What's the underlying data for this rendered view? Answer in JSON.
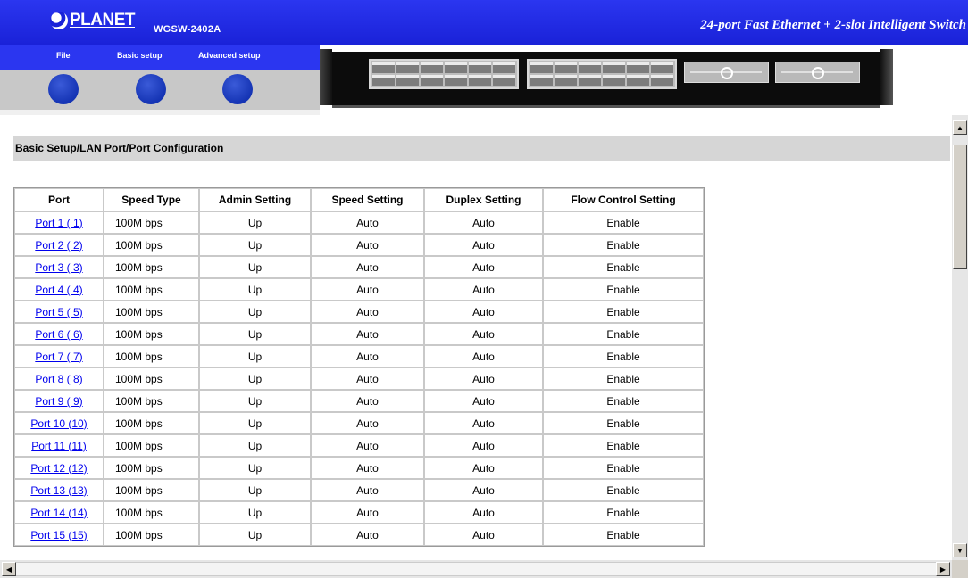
{
  "header": {
    "brand": "PLANET",
    "model": "WGSW-2402A",
    "tagline": "24-port Fast Ethernet + 2-slot Intelligent Switch"
  },
  "menu": [
    {
      "label": "File"
    },
    {
      "label": "Basic setup"
    },
    {
      "label": "Advanced setup"
    }
  ],
  "page": {
    "title": "Basic Setup/LAN Port/Port Configuration"
  },
  "table": {
    "headers": [
      "Port",
      "Speed Type",
      "Admin Setting",
      "Speed Setting",
      "Duplex Setting",
      "Flow Control Setting"
    ],
    "rows": [
      {
        "port": "Port 1 ( 1)",
        "speed_type": "100M bps",
        "admin": "Up",
        "speed": "Auto",
        "duplex": "Auto",
        "flow": "Enable"
      },
      {
        "port": "Port 2 ( 2)",
        "speed_type": "100M bps",
        "admin": "Up",
        "speed": "Auto",
        "duplex": "Auto",
        "flow": "Enable"
      },
      {
        "port": "Port 3 ( 3)",
        "speed_type": "100M bps",
        "admin": "Up",
        "speed": "Auto",
        "duplex": "Auto",
        "flow": "Enable"
      },
      {
        "port": "Port 4 ( 4)",
        "speed_type": "100M bps",
        "admin": "Up",
        "speed": "Auto",
        "duplex": "Auto",
        "flow": "Enable"
      },
      {
        "port": "Port 5 ( 5)",
        "speed_type": "100M bps",
        "admin": "Up",
        "speed": "Auto",
        "duplex": "Auto",
        "flow": "Enable"
      },
      {
        "port": "Port 6 ( 6)",
        "speed_type": "100M bps",
        "admin": "Up",
        "speed": "Auto",
        "duplex": "Auto",
        "flow": "Enable"
      },
      {
        "port": "Port 7 ( 7)",
        "speed_type": "100M bps",
        "admin": "Up",
        "speed": "Auto",
        "duplex": "Auto",
        "flow": "Enable"
      },
      {
        "port": "Port 8 ( 8)",
        "speed_type": "100M bps",
        "admin": "Up",
        "speed": "Auto",
        "duplex": "Auto",
        "flow": "Enable"
      },
      {
        "port": "Port 9 ( 9)",
        "speed_type": "100M bps",
        "admin": "Up",
        "speed": "Auto",
        "duplex": "Auto",
        "flow": "Enable"
      },
      {
        "port": "Port 10 (10)",
        "speed_type": "100M bps",
        "admin": "Up",
        "speed": "Auto",
        "duplex": "Auto",
        "flow": "Enable"
      },
      {
        "port": "Port 11 (11)",
        "speed_type": "100M bps",
        "admin": "Up",
        "speed": "Auto",
        "duplex": "Auto",
        "flow": "Enable"
      },
      {
        "port": "Port 12 (12)",
        "speed_type": "100M bps",
        "admin": "Up",
        "speed": "Auto",
        "duplex": "Auto",
        "flow": "Enable"
      },
      {
        "port": "Port 13 (13)",
        "speed_type": "100M bps",
        "admin": "Up",
        "speed": "Auto",
        "duplex": "Auto",
        "flow": "Enable"
      },
      {
        "port": "Port 14 (14)",
        "speed_type": "100M bps",
        "admin": "Up",
        "speed": "Auto",
        "duplex": "Auto",
        "flow": "Enable"
      },
      {
        "port": "Port 15 (15)",
        "speed_type": "100M bps",
        "admin": "Up",
        "speed": "Auto",
        "duplex": "Auto",
        "flow": "Enable"
      }
    ]
  },
  "colors": {
    "header_blue": "#2b36f0",
    "title_bar_gray": "#d6d6d6",
    "link_blue": "#0000ee"
  }
}
